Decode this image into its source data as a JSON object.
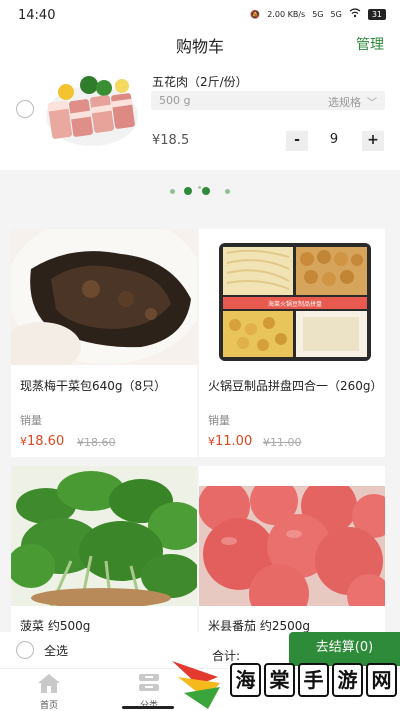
{
  "status_bar": {
    "time": "14:40",
    "network_speed": "2.00 KB/s",
    "signal_1": "5G",
    "signal_2": "5G",
    "battery": "31"
  },
  "header": {
    "title": "购物车",
    "manage_label": "管理"
  },
  "cart_item": {
    "name": "五花肉（2斤/份）",
    "weight": "500 g",
    "select_spec_label": "选规格",
    "price": "¥18.5",
    "minus": "-",
    "quantity": "9",
    "plus": "+"
  },
  "products": [
    {
      "name": "现蒸梅干菜包640g（8只）",
      "sales_label": "销量",
      "price": "18.60",
      "original_price": "¥18.60",
      "currency": "¥"
    },
    {
      "name": "火锅豆制品拼盘四合一（260g）",
      "sales_label": "销量",
      "price": "11.00",
      "original_price": "¥11.00",
      "currency": "¥"
    },
    {
      "name": "菠菜 约500g"
    },
    {
      "name": "米县番茄 约2500g"
    }
  ],
  "product_package_label": "海莱火锅豆制品拼盘",
  "checkout": {
    "select_all_label": "全选",
    "total_label": "合计:",
    "settle_label": "去结算(0)"
  },
  "tabs": [
    {
      "label": "首页"
    },
    {
      "label": "分类"
    }
  ],
  "watermark": {
    "chars": [
      "海",
      "棠",
      "手",
      "游",
      "网"
    ]
  },
  "colors": {
    "accent": "#2e8b3a",
    "price": "#e0471f"
  }
}
